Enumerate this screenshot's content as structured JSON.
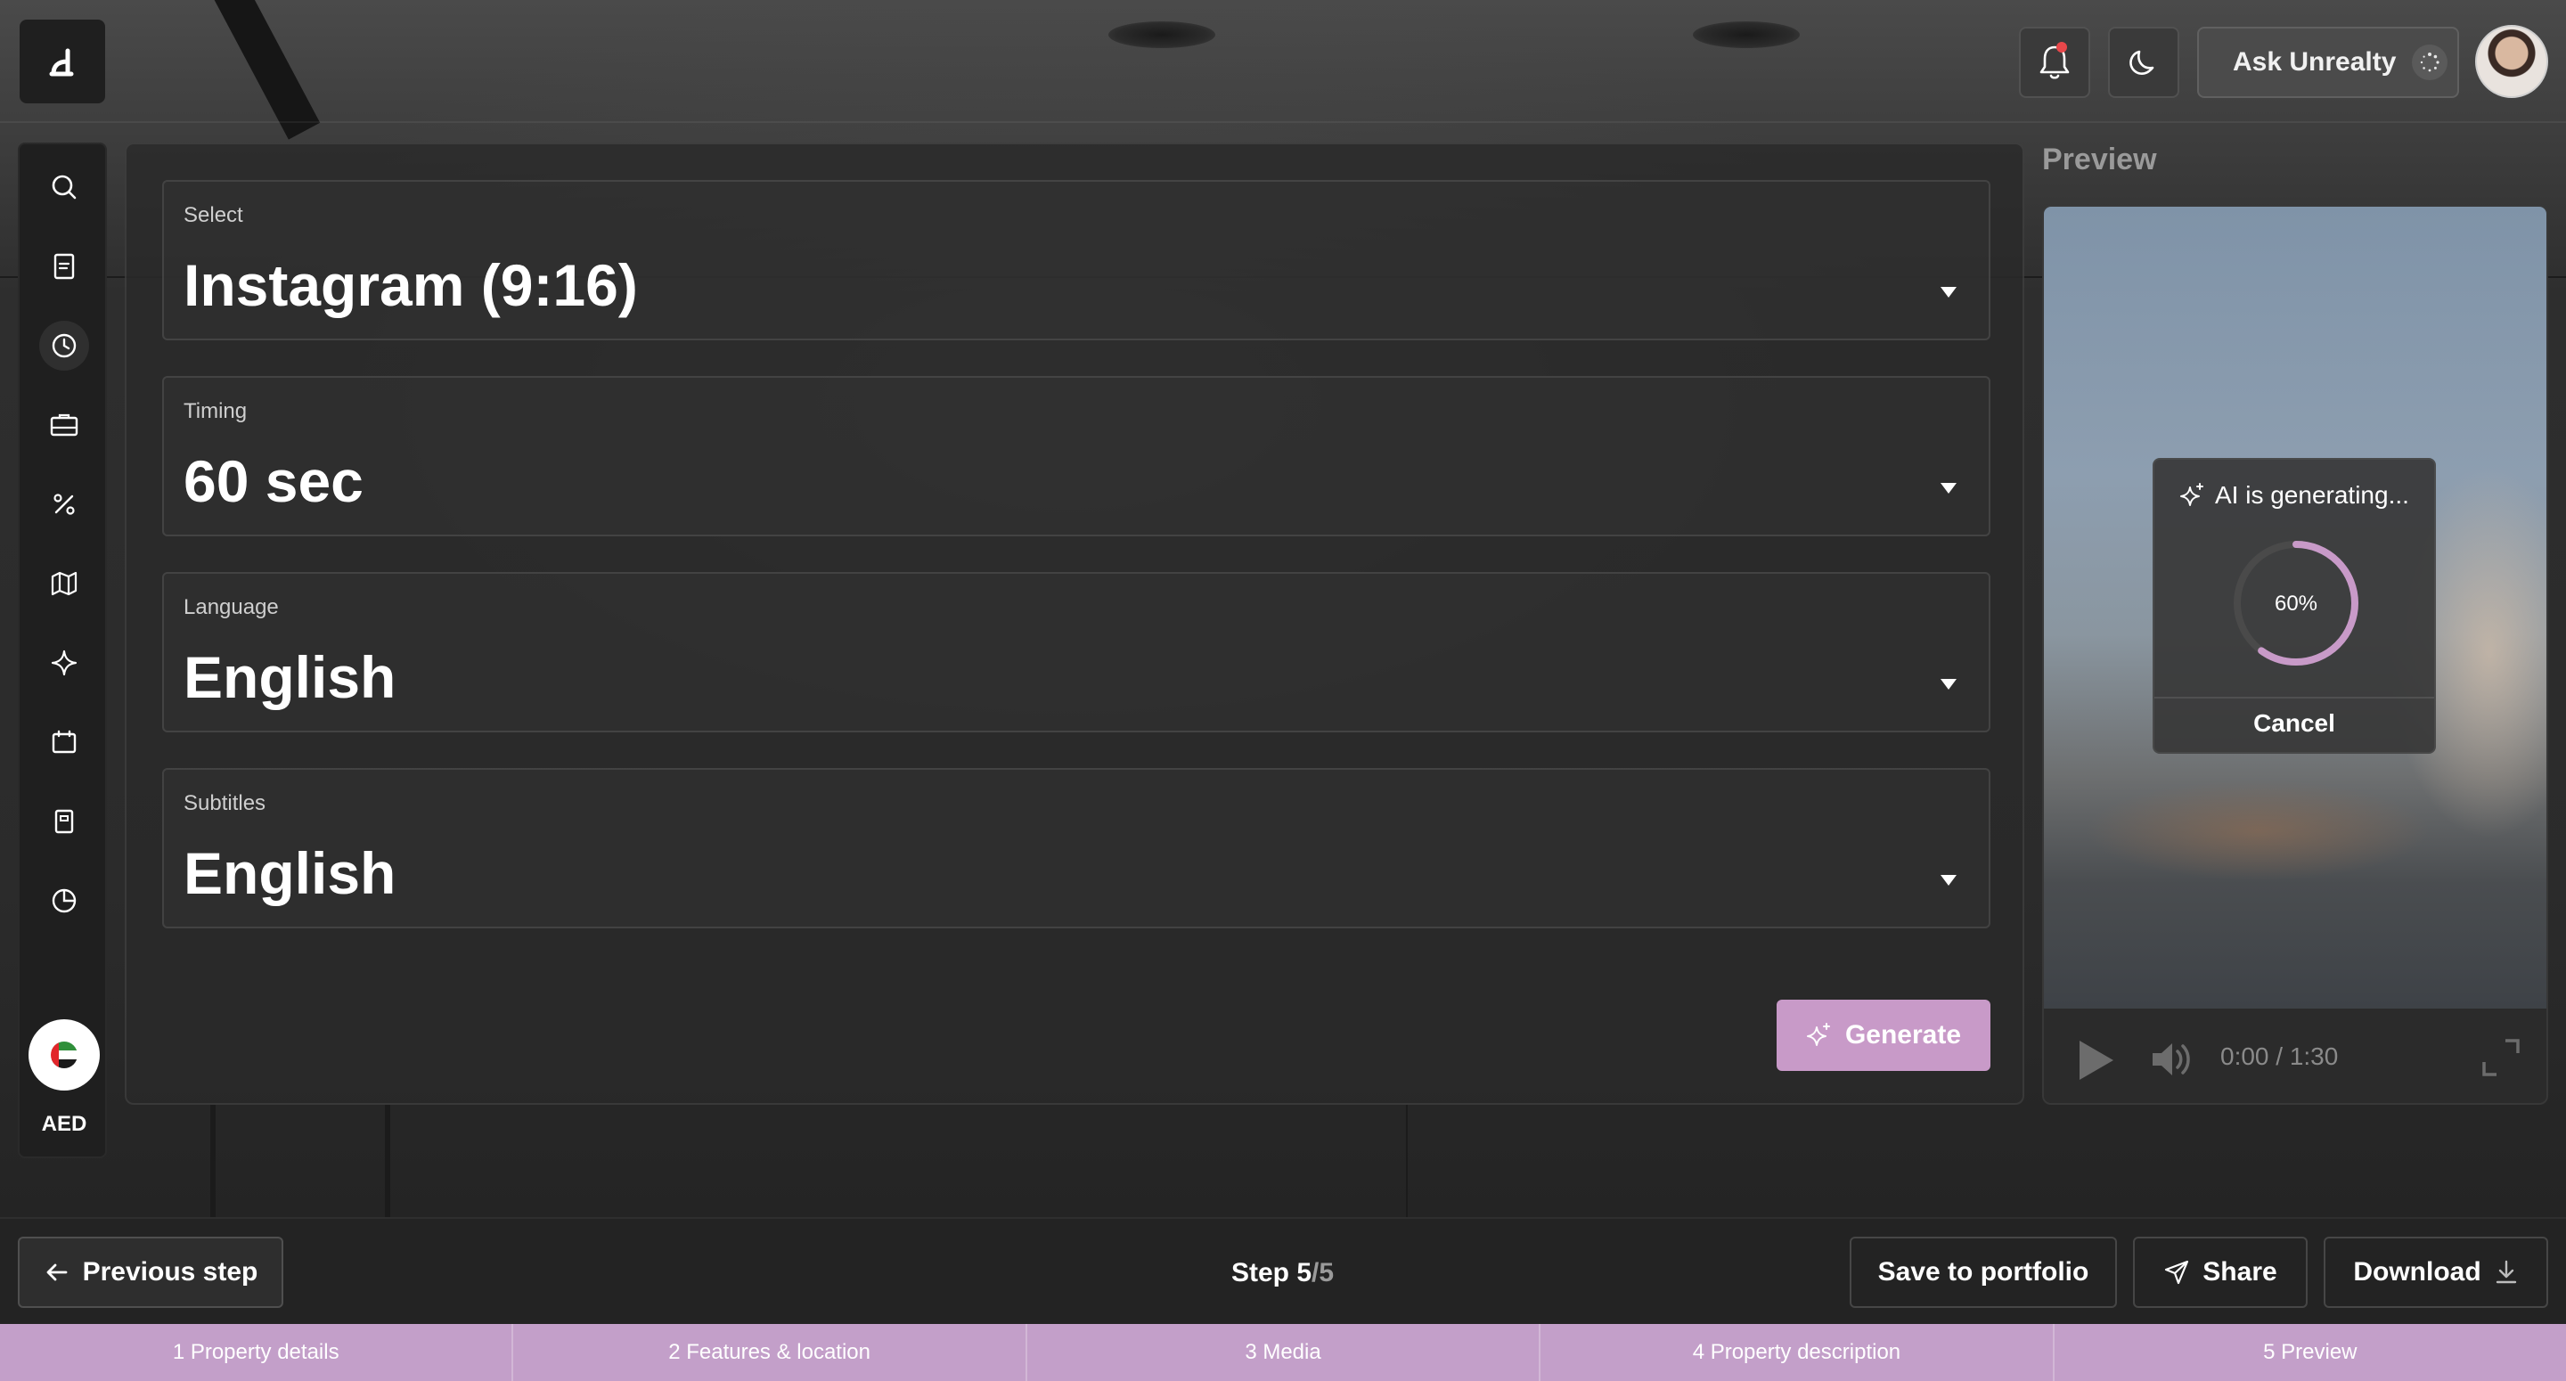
{
  "header": {
    "logo_glyph": "ᑯ",
    "ask_button_label": "Ask Unrealty"
  },
  "sidebar": {
    "items": [
      {
        "icon": "search-icon"
      },
      {
        "icon": "document-icon"
      },
      {
        "icon": "clock-icon",
        "active": true
      },
      {
        "icon": "briefcase-icon"
      },
      {
        "icon": "percent-icon"
      },
      {
        "icon": "map-icon"
      },
      {
        "icon": "sparkle-icon"
      },
      {
        "icon": "calendar-icon"
      },
      {
        "icon": "notebook-icon"
      },
      {
        "icon": "pie-chart-icon"
      }
    ],
    "currency_label": "AED",
    "currency_flag_icon": "uae-flag-icon"
  },
  "form": {
    "fields": [
      {
        "label": "Select",
        "value": "Instagram (9:16)"
      },
      {
        "label": "Timing",
        "value": "60 sec"
      },
      {
        "label": "Language",
        "value": "English"
      },
      {
        "label": "Subtitles",
        "value": "English"
      }
    ],
    "generate_label": "Generate"
  },
  "preview": {
    "title": "Preview",
    "time": "0:00 / 1:30",
    "overlay": {
      "title": "AI is generating...",
      "progress_label": "60%",
      "progress_fraction": 0.6,
      "cancel_label": "Cancel"
    }
  },
  "footer": {
    "prev_label": "Previous step",
    "step_prefix": "Step 5",
    "step_total": "/5",
    "save_label": "Save to portfolio",
    "share_label": "Share",
    "download_label": "Download"
  },
  "steps": [
    "1 Property details",
    "2 Features & location",
    "3 Media",
    "4 Property description",
    "5 Preview"
  ],
  "colors": {
    "accent": "#c89ac8",
    "steps_bar": "#c39fc9",
    "notification_dot": "#e8474a"
  }
}
